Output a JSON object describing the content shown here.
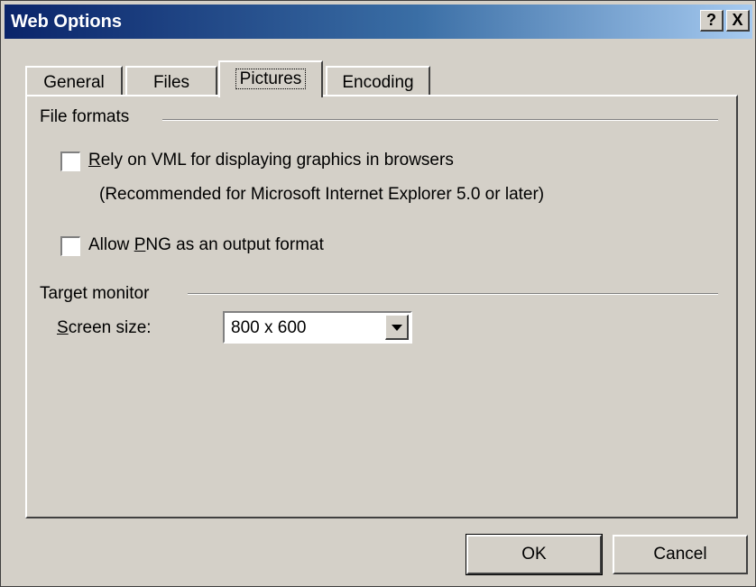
{
  "window": {
    "title": "Web Options",
    "help_label": "?",
    "close_label": "X"
  },
  "tabs": [
    {
      "label": "General"
    },
    {
      "label": "Files"
    },
    {
      "label": "Pictures",
      "active": true
    },
    {
      "label": "Encoding"
    }
  ],
  "file_formats": {
    "heading": "File formats",
    "vml": {
      "label_pre": "R",
      "label_rest": "ely on VML for displaying graphics in browsers",
      "checked": false,
      "note": "(Recommended for Microsoft Internet Explorer 5.0 or later)"
    },
    "png": {
      "label_pre": "Allow ",
      "label_key": "P",
      "label_rest": "NG as an output format",
      "checked": false
    }
  },
  "target_monitor": {
    "heading": "Target monitor",
    "screen_size_key": "S",
    "screen_size_rest": "creen size:",
    "screen_size_value": "800 x 600"
  },
  "buttons": {
    "ok": "OK",
    "cancel": "Cancel"
  },
  "colors": {
    "title_start": "#0a246a",
    "title_end": "#a6caf0",
    "face": "#d4d0c8"
  }
}
